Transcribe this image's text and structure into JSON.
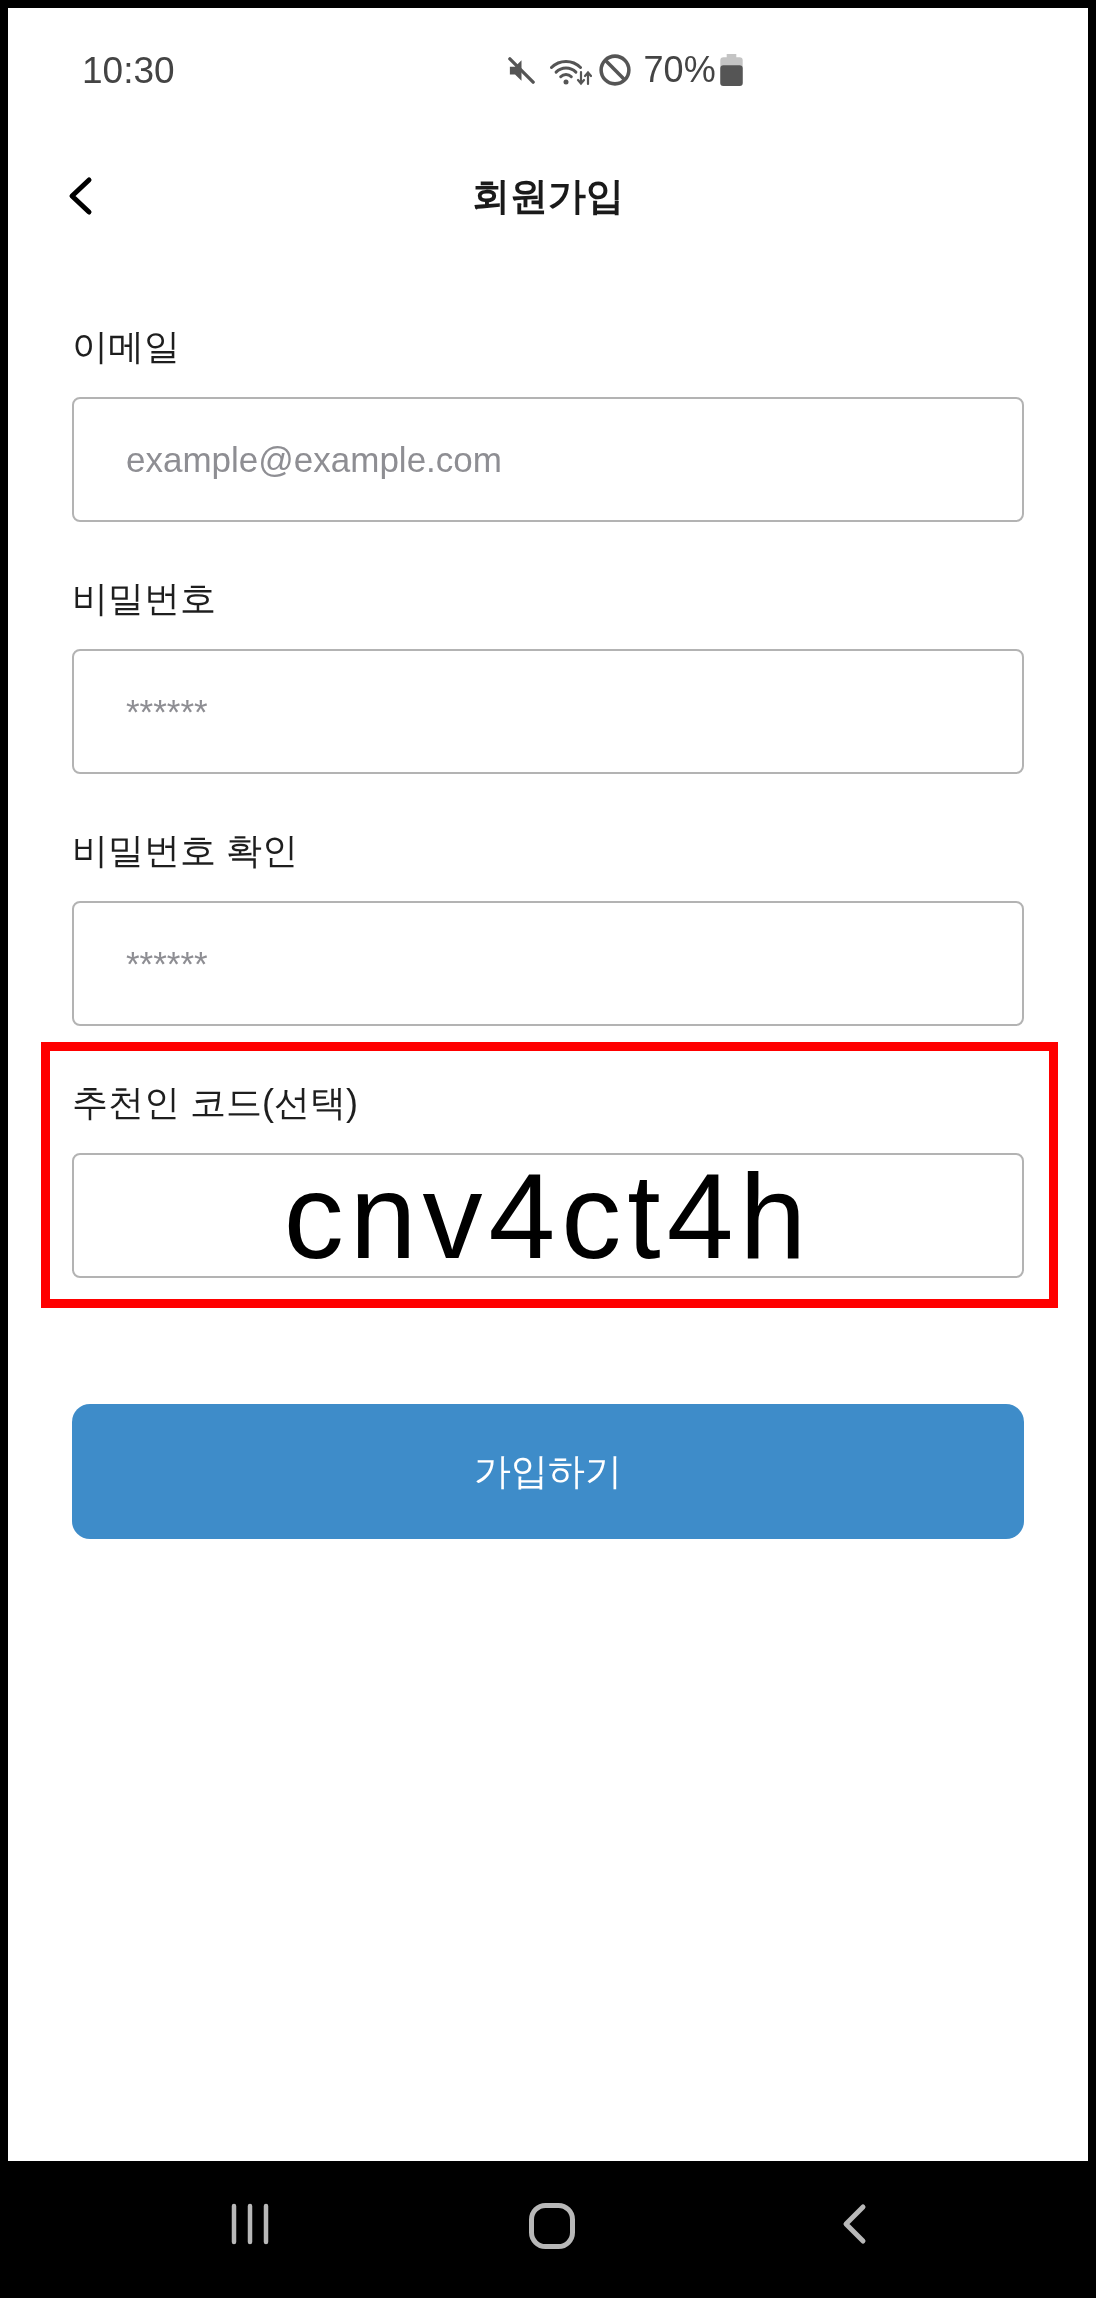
{
  "status_bar": {
    "time": "10:30",
    "battery": "70%"
  },
  "header": {
    "title": "회원가입"
  },
  "fields": [
    {
      "label": "이메일",
      "placeholder": "example@example.com",
      "highlighted": false
    },
    {
      "label": "비밀번호",
      "placeholder": "******",
      "highlighted": false
    },
    {
      "label": "비밀번호 확인",
      "placeholder": "******",
      "highlighted": false
    },
    {
      "label": "추천인 코드(선택)",
      "value": "cnv4ct4h",
      "highlighted": true
    }
  ],
  "submit_button": {
    "label": "가입하기"
  }
}
